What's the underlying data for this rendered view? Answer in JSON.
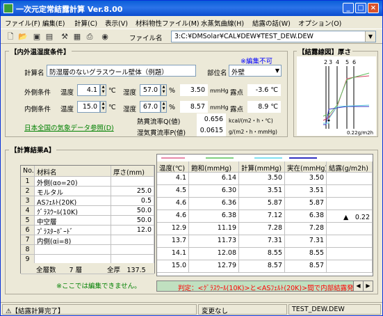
{
  "title": "一次元定常結露計算 Ver.8.00",
  "menu": [
    "ファイル(F)",
    "編集(E)",
    "計算(C)",
    "表示(V)",
    "材料物性ファイル(M)",
    "水蒸気曲線(H)",
    "結露の話(W)",
    "オプション(O)"
  ],
  "toolbar": {
    "file_label": "ファイル名",
    "file_path": "3:C:¥DMSolar¥CAL¥DEW¥TEST_DEW.DEW"
  },
  "cond": {
    "title": "【内外温湿度条件】",
    "note": "※編集不可",
    "calc_name_label": "計算名",
    "calc_name": "防湿層のないグラスウール壁体（例題）",
    "part_label": "部位名",
    "part": "外壁",
    "out_label": "外側条件",
    "in_label": "内側条件",
    "temp_label": "温度",
    "hum_label": "湿度",
    "deg": "℃",
    "pct": "%",
    "out_temp": "4.1",
    "out_hum": "57.0",
    "out_vp": "3.50",
    "in_temp": "15.0",
    "in_hum": "67.0",
    "in_vp": "8.57",
    "mmhg": "mmHg",
    "dew_label": "露点",
    "out_dew": "-3.6 ℃",
    "in_dew": "8.9 ℃",
    "heat_label": "熱貫流率Q(値)",
    "heat_val": "0.656",
    "heat_unit": "kcal/(m2・h・℃)",
    "moist_label": "湿気貫流率P(値)",
    "moist_val": "0.0615",
    "moist_unit": "g/(m2・h・mmHg)",
    "weather_link": "日本全国の気象データ参照(D)"
  },
  "graph": {
    "title": "【結露線図】厚さ",
    "layer_labels": [
      "2",
      "3",
      "4",
      "5",
      "6"
    ],
    "footer": "0.22g/m2h"
  },
  "result": {
    "title": "【計算結果A】",
    "hdr_no": "No.",
    "hdr_mat": "材料名",
    "hdr_thick": "厚さ(mm)",
    "rows": [
      {
        "no": "1",
        "name": "外側(αo=20)",
        "thick": ""
      },
      {
        "no": "2",
        "name": "モルタル",
        "thick": "25.0"
      },
      {
        "no": "3",
        "name": "ASﾌｪﾙﾄ(20K)",
        "thick": "0.5"
      },
      {
        "no": "4",
        "name": "ｸﾞﾗｽｳｰﾙ(10K)",
        "thick": "50.0"
      },
      {
        "no": "5",
        "name": "中空層",
        "thick": "50.0"
      },
      {
        "no": "6",
        "name": "ﾌﾟﾗｽﾀｰﾎﾞｰﾄﾞ",
        "thick": "12.0"
      },
      {
        "no": "7",
        "name": "内側(αi=8)",
        "thick": ""
      },
      {
        "no": "8",
        "name": "",
        "thick": ""
      },
      {
        "no": "9",
        "name": "",
        "thick": ""
      }
    ],
    "footer_layers": "全層数　　7 層",
    "footer_total": "全厚　137.5",
    "note": "※ここでは編集できません。",
    "hdr2": [
      "温度(℃)",
      "飽和(mmHg)",
      "計算(mmHg)",
      "実在(mmHg)",
      "結露(g/m2h)"
    ],
    "rows2": [
      [
        "4.1",
        "6.14",
        "3.50",
        "3.50",
        ""
      ],
      [
        "4.5",
        "6.30",
        "3.51",
        "3.51",
        ""
      ],
      [
        "4.6",
        "6.36",
        "5.87",
        "5.87",
        ""
      ],
      [
        "4.6",
        "6.38",
        "7.12",
        "6.38",
        "▲　0.22"
      ],
      [
        "12.9",
        "11.19",
        "7.28",
        "7.28",
        ""
      ],
      [
        "13.7",
        "11.73",
        "7.31",
        "7.31",
        ""
      ],
      [
        "14.1",
        "12.08",
        "8.55",
        "8.55",
        ""
      ],
      [
        "15.0",
        "12.79",
        "8.57",
        "8.57",
        ""
      ]
    ],
    "judge": "判定：<ｸﾞﾗｽｳｰﾙ(10K)>と<ASﾌｪﾙﾄ(20K)>間で内部結露発生"
  },
  "status": [
    "⚠【結露計算完了】",
    "変更なし",
    "TEST_DEW.DEW"
  ],
  "colors": {
    "title_bar": "#0a5fd8",
    "line_pink": "#e88aa8",
    "line_green": "#80d080",
    "line_cyan": "#80e0f0",
    "line_blue": "#3030c0",
    "judge_bg": "#c0e0c0",
    "judge_text": "#ff0000"
  }
}
